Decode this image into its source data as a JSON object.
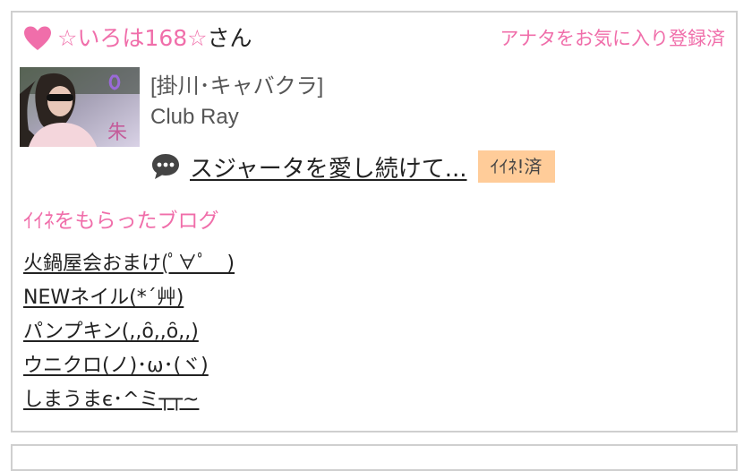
{
  "user": {
    "star_name": "☆いろは168☆",
    "honorific": "さん"
  },
  "favorite": {
    "status_label": "アナタをお気に入り登録済"
  },
  "shop": {
    "category": "[掛川･キャバクラ]",
    "name": "Club Ray"
  },
  "featured_blog": {
    "title": "スジャータを愛し続けて...",
    "badge": "ｲｲﾈ!済"
  },
  "liked_blogs": {
    "heading": "ｲｲﾈをもらったブログ",
    "items": [
      {
        "title": "火鍋屋会おまけ(ﾟ∀ﾟ　)"
      },
      {
        "title": "NEWネイル(*´艸)"
      },
      {
        "title": "パンプキン(,,ȏ,,ȏ,,)"
      },
      {
        "title": "ウニクロ(ノ)･ω･(ヾ)"
      },
      {
        "title": "しまうまє･^ミ┬┬~"
      }
    ]
  },
  "colors": {
    "accent_pink": "#f06eaa",
    "badge_bg": "#ffcc99",
    "border": "#cfcfcf"
  },
  "icons": {
    "heart": "heart-icon",
    "chat": "speech-bubble-icon"
  }
}
